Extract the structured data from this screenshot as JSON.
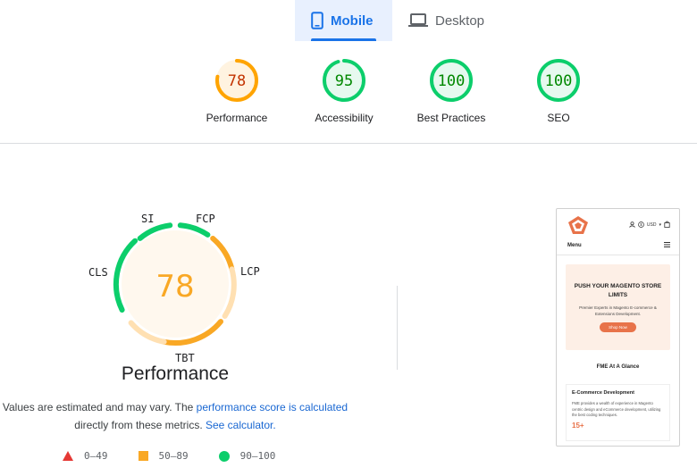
{
  "tabs": [
    {
      "label": "Mobile",
      "icon": "smartphone-icon",
      "active": true
    },
    {
      "label": "Desktop",
      "icon": "laptop-icon",
      "active": false
    }
  ],
  "gauges": [
    {
      "score": "78",
      "label": "Performance",
      "value": 78,
      "status": "average"
    },
    {
      "score": "95",
      "label": "Accessibility",
      "value": 95,
      "status": "pass"
    },
    {
      "score": "100",
      "label": "Best Practices",
      "value": 100,
      "status": "pass"
    },
    {
      "score": "100",
      "label": "SEO",
      "value": 100,
      "status": "pass"
    }
  ],
  "colors": {
    "pass": "#0cce6b",
    "average": "#ffa400",
    "fail": "#ff4e42",
    "pass_bg": "#e6f9ef",
    "average_bg": "#fff3e0",
    "accent": "#1a73e8"
  },
  "performance": {
    "score": "78",
    "title": "Performance",
    "metrics": {
      "si": "SI",
      "fcp": "FCP",
      "lcp": "LCP",
      "tbt": "TBT",
      "cls": "CLS"
    }
  },
  "description": {
    "text1": "Values are estimated and may vary. The ",
    "link1": "performance score is calculated",
    "text2": "directly from these metrics. ",
    "link2": "See calculator."
  },
  "legend": [
    {
      "range": "0–49",
      "shape": "triangle"
    },
    {
      "range": "50–89",
      "shape": "square"
    },
    {
      "range": "90–100",
      "shape": "circle"
    }
  ],
  "thumbnail": {
    "currency": "USD",
    "menu": "Menu",
    "hero_title": "PUSH YOUR MAGENTO STORE LIMITS",
    "hero_sub": "Premier Experts in Magento E-commerce & Extensions Development.",
    "hero_button": "Shop Now",
    "glance": "FME At A Glance",
    "card_title": "E-Commerce Development",
    "card_text": "FME provides a wealth of experience in Magento centric design and eCommerce development, utilizing the best coding techniques.",
    "card_num": "15+"
  }
}
